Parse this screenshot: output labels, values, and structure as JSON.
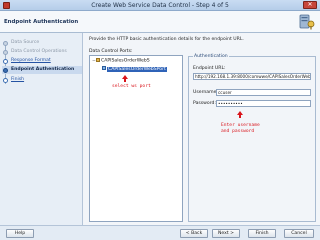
{
  "window": {
    "title": "Create Web Service Data Control - Step 4 of 5",
    "close_label": "✕"
  },
  "header": {
    "title": "Endpoint Authentication"
  },
  "steps": [
    {
      "label": "Data Source",
      "state": "done"
    },
    {
      "label": "Data Control Operations",
      "state": "done"
    },
    {
      "label": "Response Format",
      "state": "link"
    },
    {
      "label": "Endpoint Authentication",
      "state": "current"
    },
    {
      "label": "Finish",
      "state": "link"
    }
  ],
  "content": {
    "instruction": "Provide the HTTP basic authentication details for the endpoint URL.",
    "ports_label": "Data Control Ports:",
    "ports": [
      {
        "label": "CAPISalesOrderWebS",
        "expanded": true,
        "selected": false
      },
      {
        "label": "CAPISalesOrderWebSPort",
        "selected": true
      }
    ],
    "annotation_port": "select ws port",
    "annotation_credentials_line1": "Enter username",
    "annotation_credentials_line2": "and password"
  },
  "auth": {
    "legend": "Authentication",
    "endpoint_label": "Endpoint URL:",
    "endpoint_value": "http://192.168.1.39:8000/comwwe/CAPISalesOrderWebS",
    "username_label": "Username:",
    "username_value": "ccuser",
    "password_label": "Password:",
    "password_value": "••••••••••"
  },
  "footer": {
    "help": "Help",
    "back": "< Back",
    "next": "Next >",
    "finish": "Finish",
    "cancel": "Cancel"
  }
}
